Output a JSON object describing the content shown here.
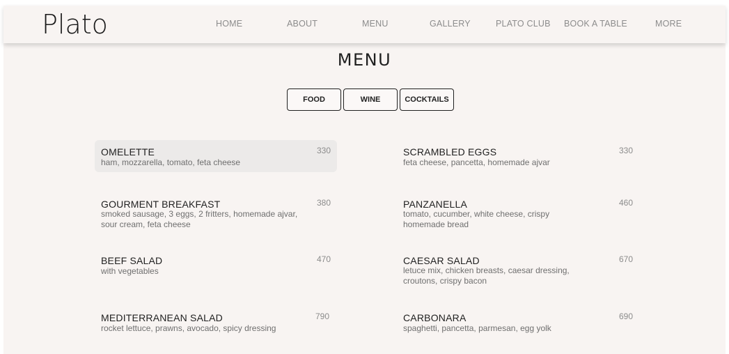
{
  "brand": {
    "name": "Plato"
  },
  "nav": {
    "items": [
      {
        "label": "HOME"
      },
      {
        "label": "ABOUT"
      },
      {
        "label": "MENU"
      },
      {
        "label": "GALLERY"
      },
      {
        "label": "PLATO CLUB"
      },
      {
        "label": "BOOK A TABLE"
      },
      {
        "label": "MORE"
      }
    ]
  },
  "page": {
    "title": "MENU"
  },
  "tabs": [
    {
      "label": "FOOD"
    },
    {
      "label": "WINE"
    },
    {
      "label": "COCKTAILS"
    }
  ],
  "menu": {
    "items": [
      {
        "name": "OMELETTE",
        "description": "ham, mozzarella, tomato, feta cheese",
        "price": "330"
      },
      {
        "name": "SCRAMBLED EGGS",
        "description": "feta cheese, pancetta, homemade ajvar",
        "price": "330"
      },
      {
        "name": "GOURMENT BREAKFAST",
        "description": "smoked sausage, 3 eggs, 2 fritters, homemade ajvar, sour cream, feta cheese",
        "price": "380"
      },
      {
        "name": "PANZANELLA",
        "description": "tomato, cucumber, white cheese, crispy homemade bread",
        "price": "460"
      },
      {
        "name": "BEEF SALAD",
        "description": "with vegetables",
        "price": "470"
      },
      {
        "name": "CAESAR SALAD",
        "description": "letuce mix, chicken breasts, caesar dressing, croutons, crispy bacon",
        "price": "670"
      },
      {
        "name": "MEDITERRANEAN SALAD",
        "description": "rocket lettuce, prawns, avocado, spicy dressing",
        "price": "790"
      },
      {
        "name": "CARBONARA",
        "description": "spaghetti, pancetta, parmesan, egg yolk",
        "price": "690"
      }
    ]
  }
}
